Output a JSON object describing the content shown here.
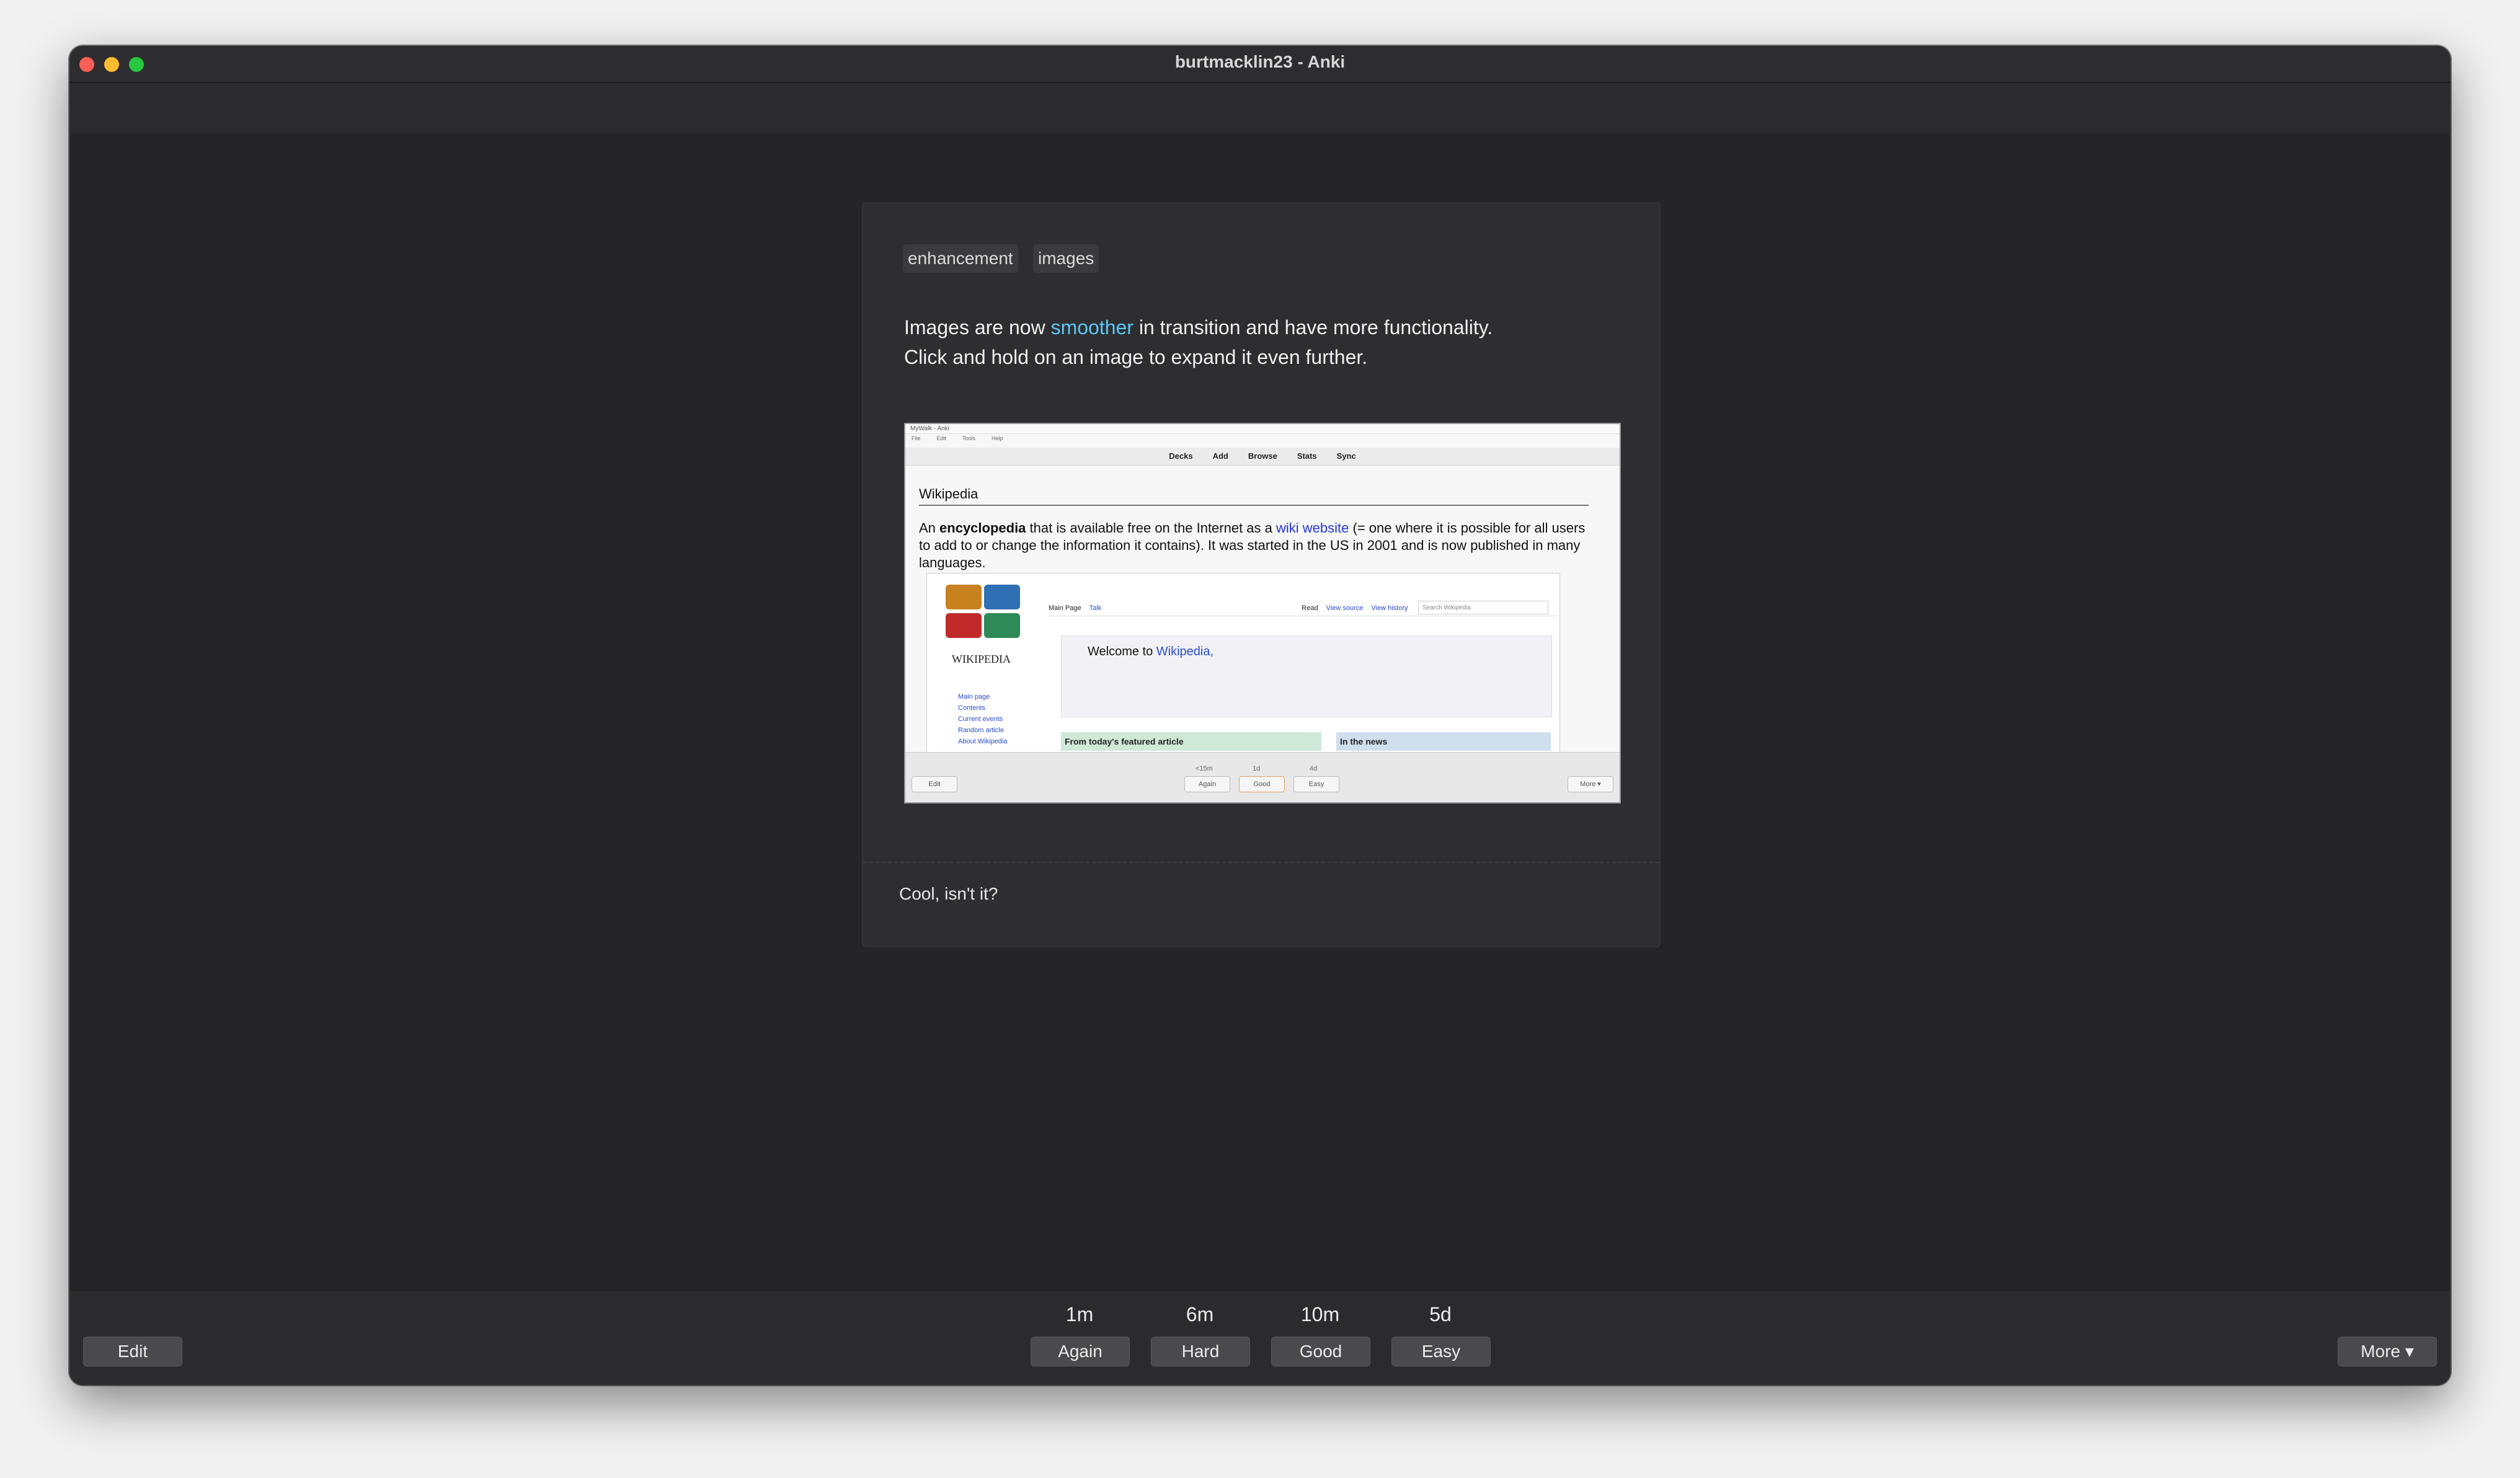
{
  "window": {
    "title": "burtmacklin23 - Anki"
  },
  "toolbar": {
    "icons": [
      "decks-icon",
      "add-icon",
      "search-icon",
      "stats-icon",
      "sync-icon"
    ],
    "sync_color": "#5ac8fa"
  },
  "card": {
    "tags": [
      "enhancement",
      "images"
    ],
    "text_before": "Images are now ",
    "text_highlight": "smoother",
    "text_after": " in transition and have more functionality.",
    "text_line2": "Click and hold on an image to expand it even further.",
    "answer": "Cool, isn't it?",
    "highlight_color": "#5ac8fa"
  },
  "screenshot": {
    "window_title": "MyWalk - Anki",
    "menu": [
      "File",
      "Edit",
      "Tools",
      "Help"
    ],
    "nav": [
      "Decks",
      "Add",
      "Browse",
      "Stats",
      "Sync"
    ],
    "heading": "Wikipedia",
    "para_prefix": "An ",
    "para_bold": "encyclopedia",
    "para_mid": " that is available free on the Internet as a ",
    "para_link": "wiki website",
    "para_rest": " (= one where it is possible for all users to add to or change the information it contains). It was started in the US in 2001 and is now published in many languages.",
    "wiki_logo_text": "WIKIPEDIA",
    "wiki_sidebar": [
      "Main page",
      "Contents",
      "Current events",
      "Random article",
      "About Wikipedia"
    ],
    "wiki_tabs": [
      "Main Page",
      "Talk",
      "Read",
      "View source",
      "View history"
    ],
    "wiki_search_placeholder": "Search Wikipedia",
    "welcome_prefix": "Welcome to ",
    "welcome_link": "Wikipedia,",
    "featured": "From today's featured article",
    "news": "In the news",
    "intervals": [
      "<15m",
      "1d",
      "4d"
    ],
    "buttons": [
      "Again",
      "Good",
      "Easy"
    ],
    "edit": "Edit",
    "more": "More ▾"
  },
  "answer_buttons": [
    {
      "interval": "1m",
      "label": "Again"
    },
    {
      "interval": "6m",
      "label": "Hard"
    },
    {
      "interval": "10m",
      "label": "Good"
    },
    {
      "interval": "5d",
      "label": "Easy"
    }
  ],
  "bottom": {
    "edit_label": "Edit",
    "more_label": "More ▾"
  }
}
